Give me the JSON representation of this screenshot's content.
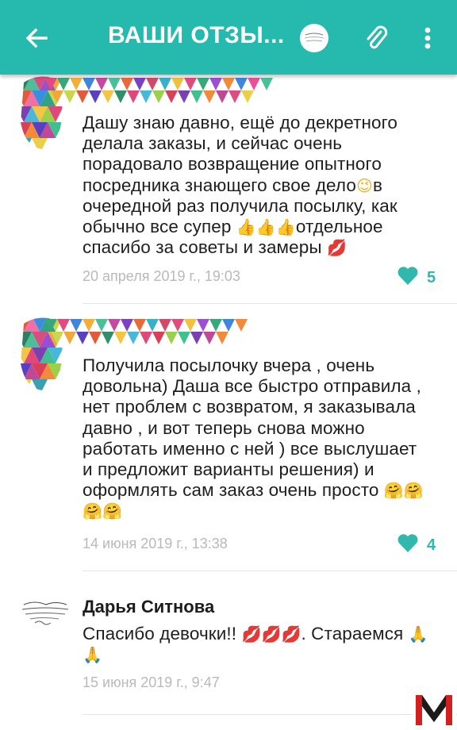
{
  "header": {
    "title": "ВАШИ ОТЗЫ...",
    "back_icon": "arrow-left-icon",
    "attach_icon": "paperclip-icon",
    "menu_icon": "more-vertical-icon",
    "color": "#26b9ad"
  },
  "comments": [
    {
      "text": "Дашу знаю давно, ещё до декретного делала заказы, и сейчас очень порадовало возвращение опытного посредника знающего свое дело",
      "emoji_1": "😉",
      "text_2": "в очередной раз получила посылку, как обычно все супер ",
      "emoji_2": "👍👍👍",
      "text_3": "отдельное спасибо за советы и замеры ",
      "emoji_3": "💋",
      "date": "20 апреля 2019 г., 19:03",
      "likes": "5"
    },
    {
      "text": "Получила посылочку вчера , очень довольна) Даша все быстро отправила , нет проблем с возвратом, я заказывала давно , и вот теперь снова можно работать именно с ней ) все выслушает и предложит варианты решения) и оформлять сам заказ очень просто ",
      "emoji_1": "🤗🤗",
      "emoji_2": "🤗🤗",
      "date": "14 июня 2019 г., 13:38",
      "likes": "4"
    },
    {
      "author": "Дарья Ситнова",
      "text": "Спасибо девочки!! ",
      "emoji_1": "💋💋💋",
      "text_2": ". Стараемся ",
      "emoji_2": "🙏",
      "emoji_3": "🙏",
      "date": "15 июня 2019 г., 9:47"
    }
  ],
  "like_color": "#2fb8ab"
}
